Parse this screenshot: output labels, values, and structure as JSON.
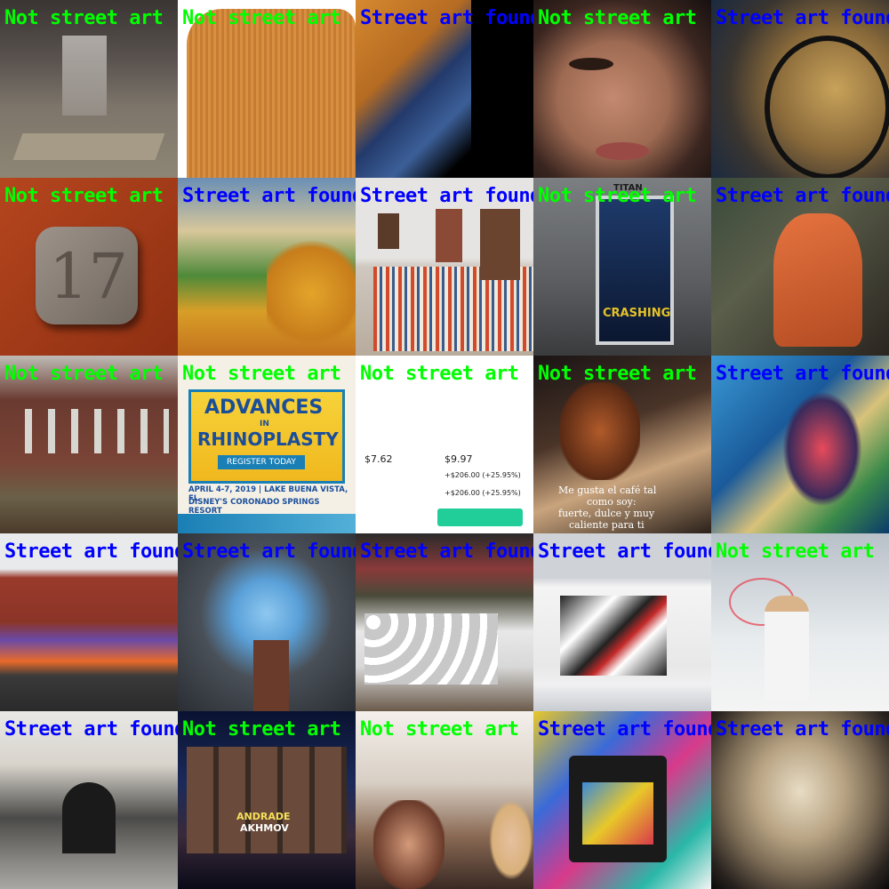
{
  "colors": {
    "positive": "#0000ff",
    "negative": "#00ff00"
  },
  "tiles": [
    {
      "label": "Not street art",
      "class": "no"
    },
    {
      "label": "Not street art",
      "class": "no"
    },
    {
      "label": "Street art found",
      "class": "yes"
    },
    {
      "label": "Not street art",
      "class": "no"
    },
    {
      "label": "Street art found",
      "class": "yes"
    },
    {
      "label": "Not street art",
      "class": "no",
      "text": "17"
    },
    {
      "label": "Street art found",
      "class": "yes"
    },
    {
      "label": "Street art found",
      "class": "yes"
    },
    {
      "label": "Not street art",
      "class": "no",
      "text": "CRASHING",
      "text2": "TITAN"
    },
    {
      "label": "Street art found",
      "class": "yes"
    },
    {
      "label": "Not street art",
      "class": "no"
    },
    {
      "label": "Not street art",
      "class": "no",
      "text": "ADVANCES",
      "text2": "IN",
      "text3": "RHINOPLASTY",
      "text4": "REGISTER TODAY",
      "text5": "APRIL 4-7, 2019 | LAKE BUENA VISTA, FL",
      "text6": "DISNEY'S CORONADO SPRINGS RESORT"
    },
    {
      "label": "Not street art",
      "class": "no",
      "text": "+$206.00 (+25.95%)",
      "text2": "+$206.00 (+25.95%)",
      "text3": "$7.62",
      "text4": "$9.97"
    },
    {
      "label": "Not street art",
      "class": "no",
      "text": "Me gusta el café tal",
      "text2": "como soy:",
      "text3": "fuerte, dulce y muy",
      "text4": "caliente para ti"
    },
    {
      "label": "Street art found",
      "class": "yes"
    },
    {
      "label": "Street art found",
      "class": "yes"
    },
    {
      "label": "Street art found",
      "class": "yes"
    },
    {
      "label": "Street art found",
      "class": "yes"
    },
    {
      "label": "Street art found",
      "class": "yes"
    },
    {
      "label": "Not street art",
      "class": "no"
    },
    {
      "label": "Street art found",
      "class": "yes"
    },
    {
      "label": "Not street art",
      "class": "no",
      "text": "ANDRADE",
      "text2": "AKHMOV"
    },
    {
      "label": "Not street art",
      "class": "no"
    },
    {
      "label": "Street art found",
      "class": "yes"
    },
    {
      "label": "Street art found",
      "class": "yes"
    }
  ]
}
